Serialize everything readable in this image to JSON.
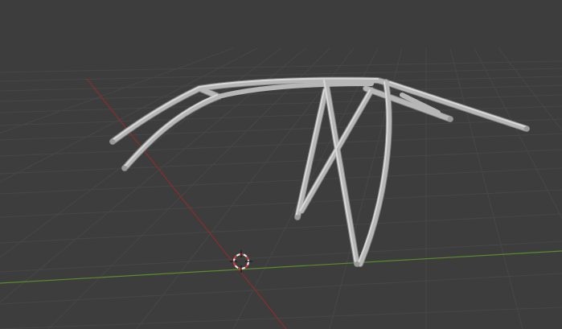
{
  "viewport": {
    "mode": "3d-viewport",
    "background_color": "#3d3d3d",
    "grid_color": "#4a4a4a",
    "x_axis_color": "#8b2d2d",
    "y_axis_color": "#5c8a2e",
    "mesh_color": "#b8b8b8",
    "mesh_highlight_color": "#d4d4d4",
    "mesh_shadow_color": "#8c8c8c",
    "cursor_colors": [
      "#e8e8e8",
      "#d63a3a"
    ]
  },
  "scene_objects": [
    {
      "name": "roll-cage-mesh",
      "type": "mesh",
      "selected": false
    },
    {
      "name": "3d-cursor",
      "type": "cursor"
    }
  ]
}
